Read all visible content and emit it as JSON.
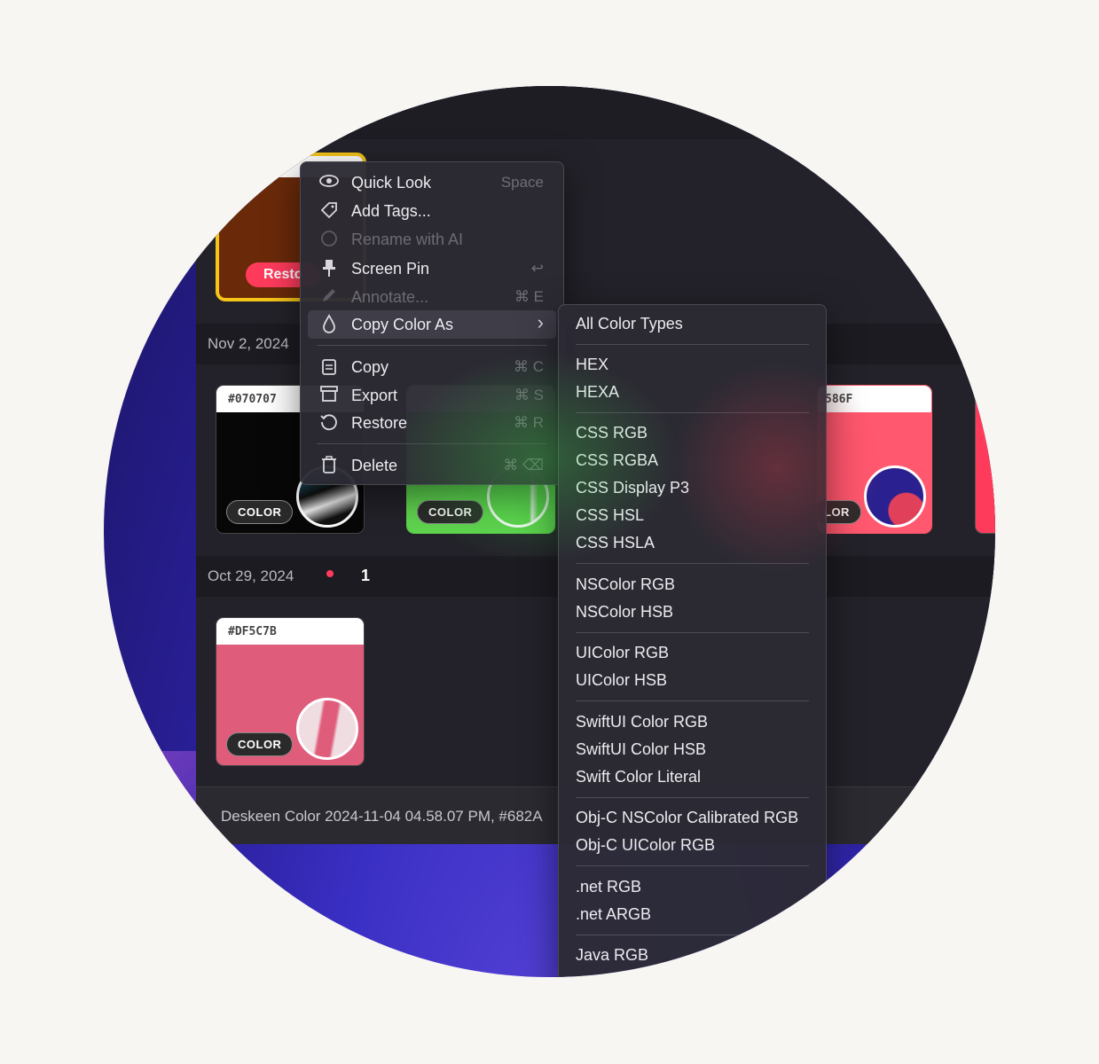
{
  "context_menu": {
    "items": [
      {
        "label": "Quick Look",
        "shortcut": "Space",
        "icon": "eye-icon",
        "glyph": "👁",
        "disabled": false
      },
      {
        "label": "Add Tags...",
        "shortcut": "",
        "icon": "tag-icon",
        "glyph": "◇",
        "disabled": false
      },
      {
        "label": "Rename with AI",
        "shortcut": "",
        "icon": "ai-head-icon",
        "glyph": "☺",
        "disabled": true
      },
      {
        "label": "Screen Pin",
        "shortcut": "↩",
        "icon": "pin-icon",
        "glyph": "📌",
        "disabled": false
      },
      {
        "label": "Annotate...",
        "shortcut": "⌘ E",
        "icon": "pencil-icon",
        "glyph": "✎",
        "disabled": true
      },
      {
        "label": "Copy Color As",
        "shortcut": "›",
        "icon": "droplet-icon",
        "glyph": "💧",
        "disabled": false
      },
      {
        "label": "Copy",
        "shortcut": "⌘ C",
        "icon": "copy-doc-icon",
        "glyph": "📋",
        "disabled": false
      },
      {
        "label": "Export",
        "shortcut": "⌘ S",
        "icon": "archive-icon",
        "glyph": "🗃",
        "disabled": false
      },
      {
        "label": "Restore",
        "shortcut": "⌘ R",
        "icon": "restore-icon",
        "glyph": "⟲",
        "disabled": false
      },
      {
        "label": "Delete",
        "shortcut": "⌘ ⌫",
        "icon": "trash-icon",
        "glyph": "🗑",
        "disabled": false
      }
    ]
  },
  "submenu": {
    "items": [
      "All Color Types",
      "HEX",
      "HEXA",
      "CSS RGB",
      "CSS RGBA",
      "CSS Display P3",
      "CSS HSL",
      "CSS HSLA",
      "NSColor RGB",
      "NSColor HSB",
      "UIColor RGB",
      "UIColor HSB",
      "SwiftUI Color RGB",
      "SwiftUI Color HSB",
      "Swift Color Literal",
      "Obj-C NSColor Calibrated RGB",
      "Obj-C UIColor RGB",
      ".net RGB",
      ".net ARGB",
      "Java RGB"
    ]
  },
  "sections": [
    {
      "date": "Nov 2, 2024"
    },
    {
      "date": "Oct 29, 2024",
      "count": "1"
    }
  ],
  "cards": [
    {
      "hex": "#070707",
      "badge": "COLOR",
      "color": "#070707"
    },
    {
      "hex": "",
      "badge": "COLOR",
      "color": "#5fd44e"
    },
    {
      "hex": "586F",
      "badge": "LOR",
      "color": "#ff586f"
    },
    {
      "hex": "#DF5C7B",
      "badge": "COLOR",
      "color": "#df5c7b"
    }
  ],
  "selected_card": {
    "restore_label": "Resto",
    "color": "#6a2a0a",
    "border_color": "#f5c518"
  },
  "status_bar": {
    "text": "Deskeen Color 2024-11-04 04.58.07 PM, #682A"
  },
  "colors": {
    "accent": "#ff3b5c",
    "menu_bg": "#2c2b34"
  }
}
